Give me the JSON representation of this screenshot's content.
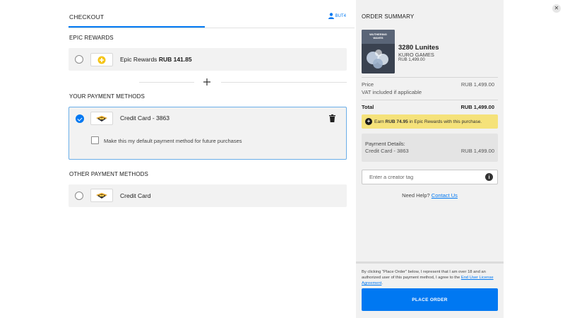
{
  "header": {
    "title": "CHECKOUT",
    "username": "BUT4"
  },
  "rewards": {
    "section_label": "EPIC REWARDS",
    "label": "Epic Rewards",
    "amount": "RUB 141.85"
  },
  "your_methods": {
    "section_label": "YOUR PAYMENT METHODS",
    "card_label": "Credit Card - 3863",
    "default_checkbox_label": "Make this my default payment method for future purchases"
  },
  "other_methods": {
    "section_label": "OTHER PAYMENT METHODS",
    "card_label": "Credit Card"
  },
  "summary": {
    "title": "ORDER SUMMARY",
    "product": {
      "name": "3280 Lunites",
      "vendor": "KURO GAMES",
      "price": "RUB 1,499.00"
    },
    "price_label": "Price",
    "price_value": "RUB 1,499.00",
    "vat_note": "VAT included if applicable",
    "total_label": "Total",
    "total_value": "RUB 1,499.00",
    "earn": {
      "prefix": "Earn",
      "amount": "RUB 74.95",
      "suffix": "in Epic Rewards with this purchase."
    },
    "payment_details": {
      "label": "Payment Details:",
      "method": "Credit Card - 3863",
      "amount": "RUB 1,499.00"
    },
    "creator_tag_placeholder": "Enter a creator tag",
    "help_text": "Need Help?",
    "help_link": "Contact Us",
    "legal_text": "By clicking \"Place Order\" below, I represent that I am over 18 and an authorized user of this payment method, I agree to the",
    "legal_link": "End User License Agreement",
    "place_order_label": "PLACE ORDER"
  },
  "colors": {
    "accent": "#0078f2",
    "earn_bg": "#f5e27a",
    "panel_bg": "#f1f1f1"
  }
}
